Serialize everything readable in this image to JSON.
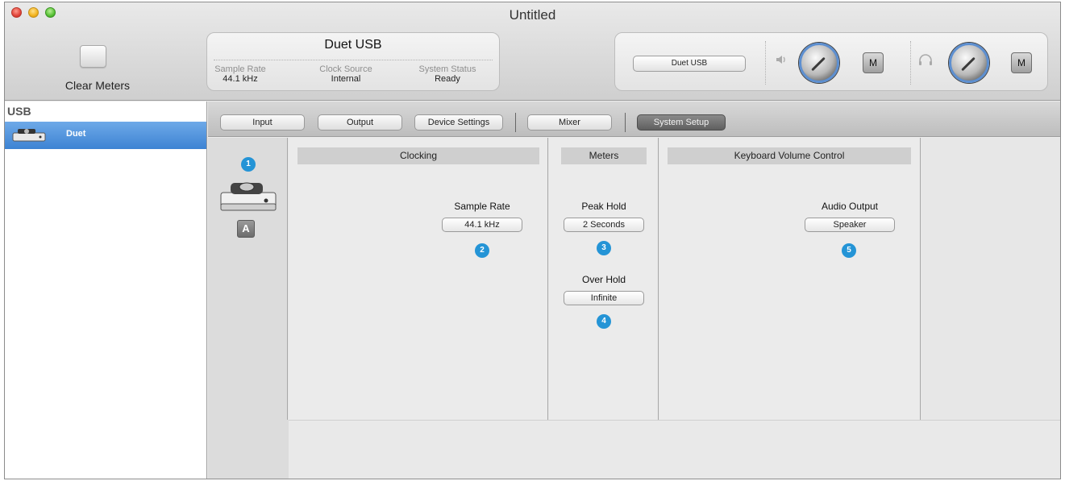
{
  "window": {
    "title": "Untitled"
  },
  "toolbar": {
    "clear_meters_label": "Clear Meters"
  },
  "device_info": {
    "name": "Duet USB",
    "sample_rate_label": "Sample Rate",
    "sample_rate_value": "44.1 kHz",
    "clock_source_label": "Clock Source",
    "clock_source_value": "Internal",
    "system_status_label": "System Status",
    "system_status_value": "Ready"
  },
  "output": {
    "device_select": "Duet USB",
    "speaker_icon": "speaker-icon",
    "headphone_icon": "headphone-icon",
    "mute_speaker_label": "M",
    "mute_headphone_label": "M",
    "knob_color": "#5d8fd0"
  },
  "sidebar": {
    "header": "USB",
    "items": [
      {
        "label": "Duet",
        "selected": true
      }
    ]
  },
  "tabs": [
    {
      "label": "Input"
    },
    {
      "label": "Output"
    },
    {
      "label": "Device Settings"
    },
    {
      "label": "Mixer"
    },
    {
      "label": "System Setup",
      "active": true
    }
  ],
  "device_column": {
    "badge": "1",
    "a_label": "A"
  },
  "clocking": {
    "header": "Clocking",
    "sample_rate_label": "Sample Rate",
    "sample_rate_value": "44.1 kHz",
    "badge": "2"
  },
  "meters": {
    "header": "Meters",
    "peak_hold_label": "Peak Hold",
    "peak_hold_value": "2 Seconds",
    "peak_badge": "3",
    "over_hold_label": "Over Hold",
    "over_hold_value": "Infinite",
    "over_badge": "4"
  },
  "keyboard": {
    "header": "Keyboard Volume Control",
    "audio_output_label": "Audio Output",
    "audio_output_value": "Speaker",
    "badge": "5"
  },
  "colors": {
    "badge": "#2494d6",
    "selection": "#3d83d3"
  }
}
